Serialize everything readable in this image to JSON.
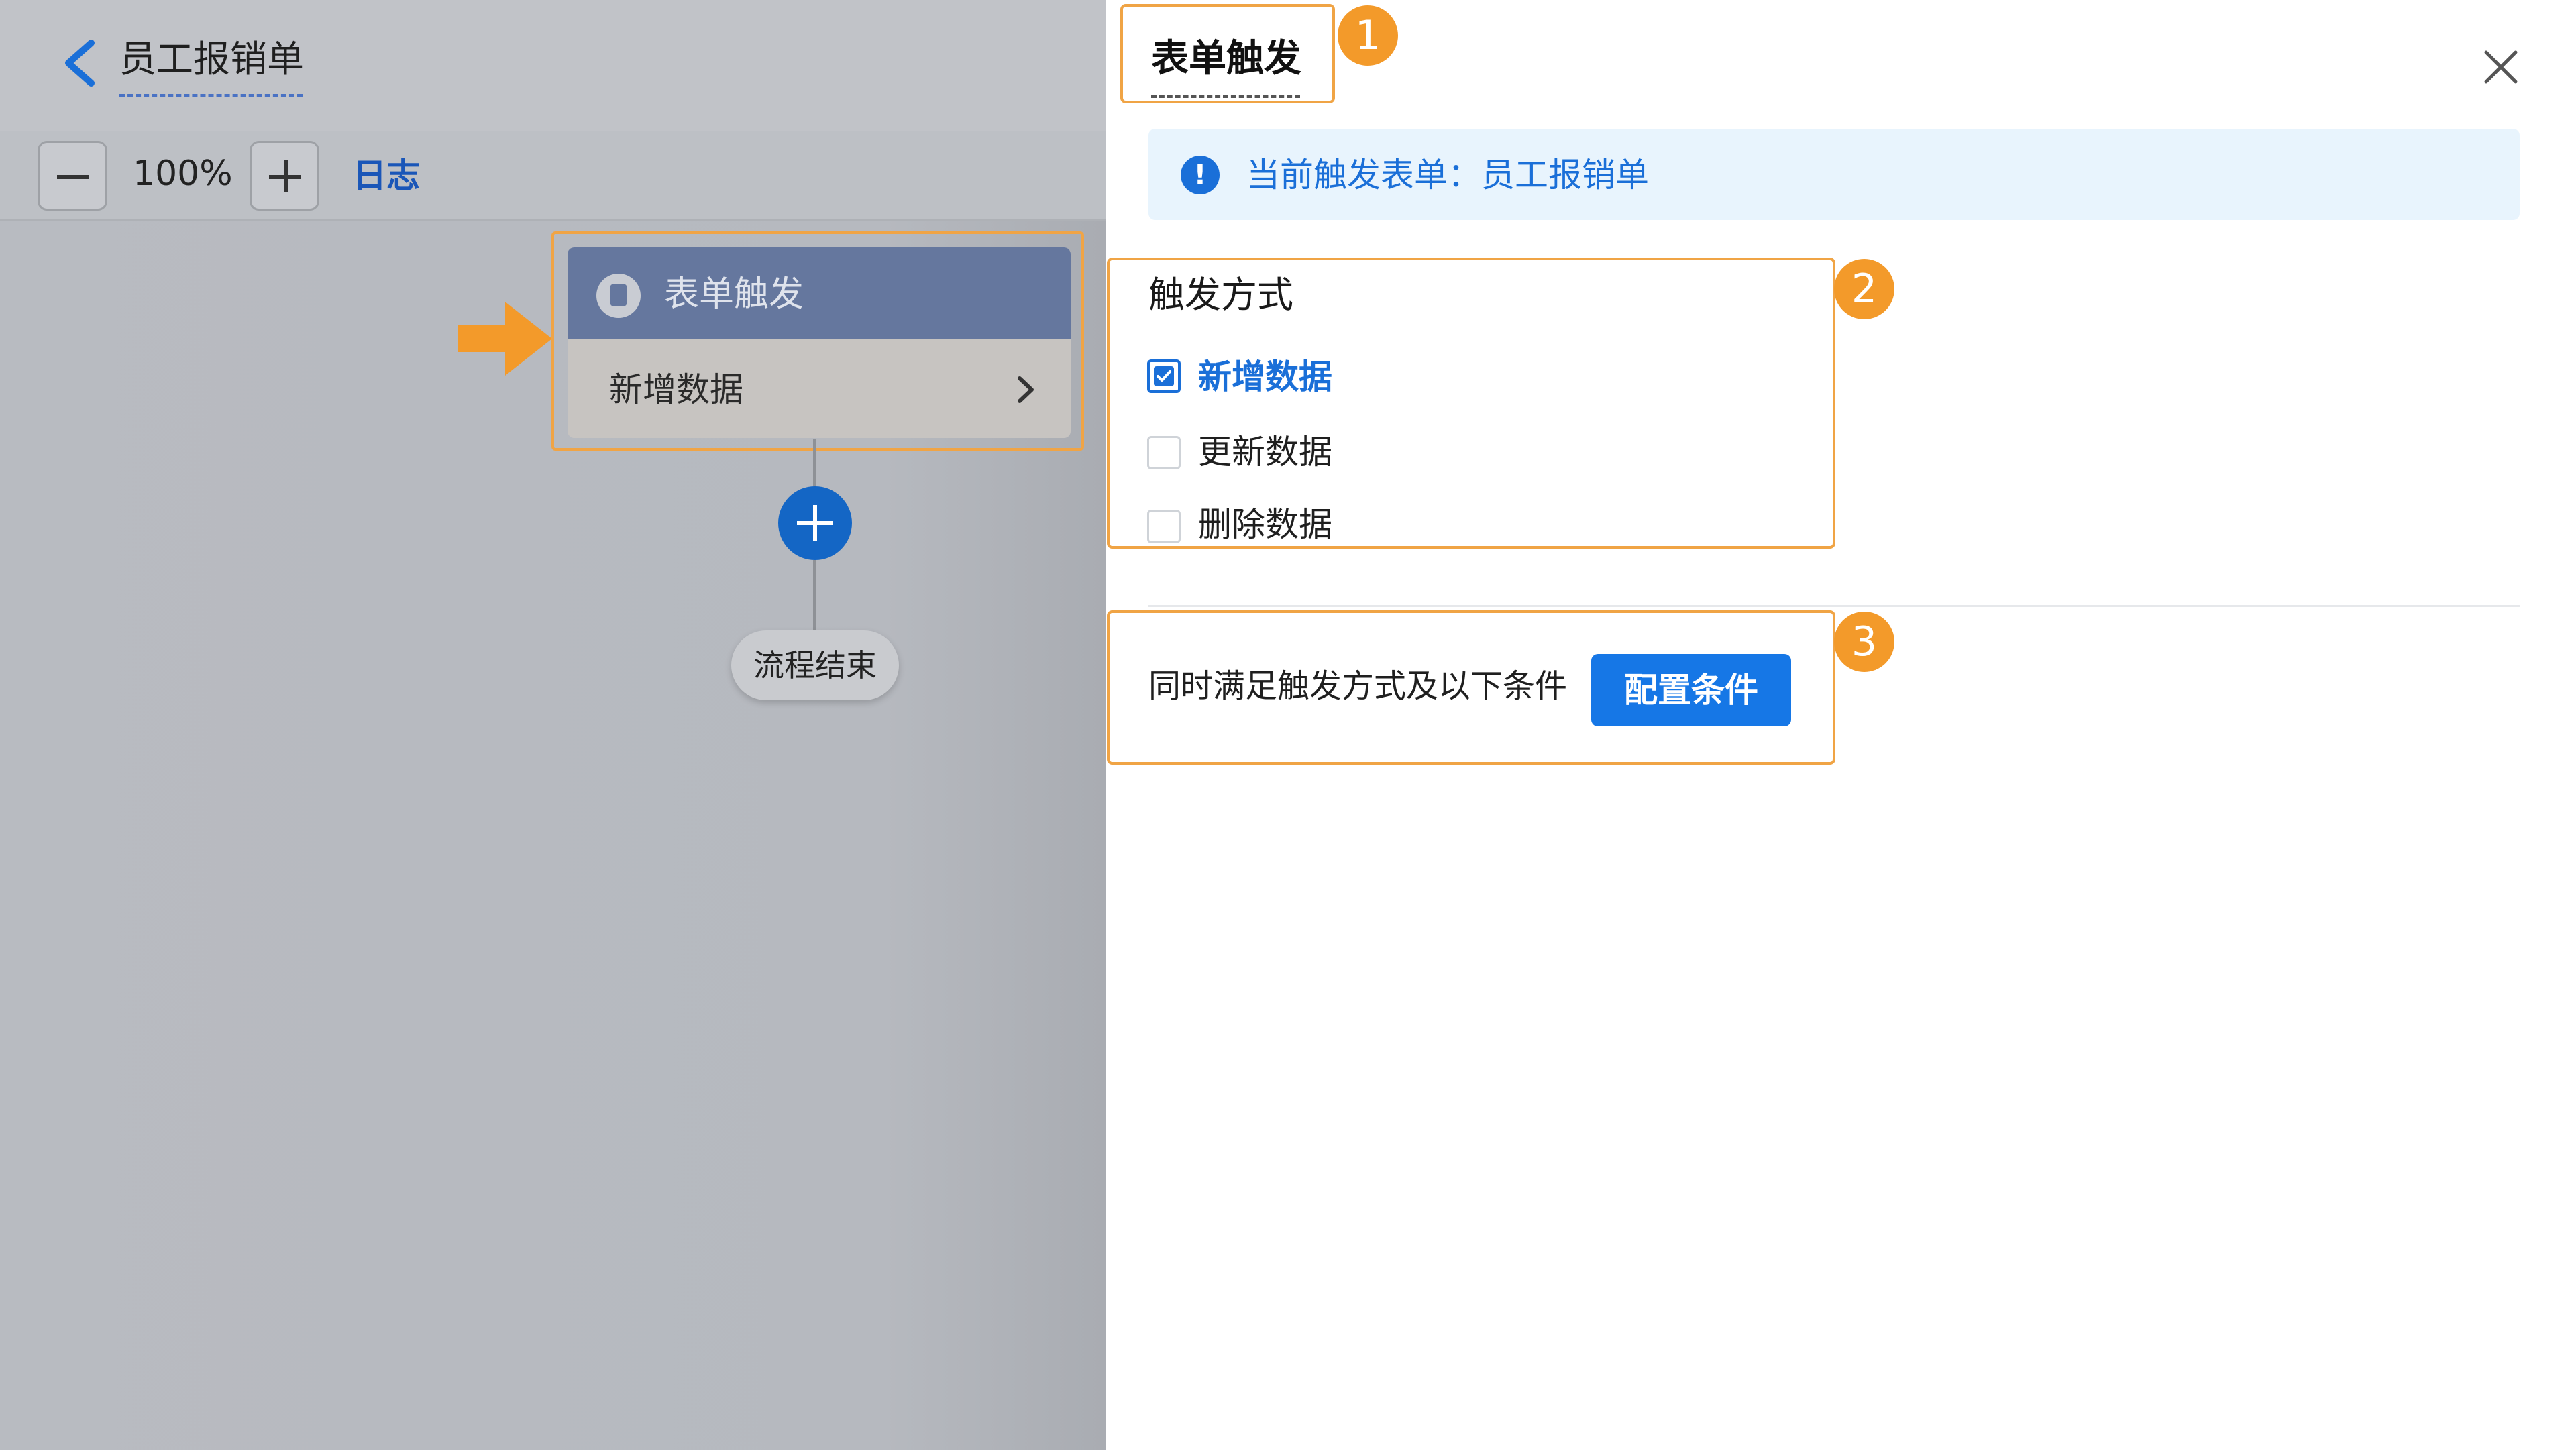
{
  "header": {
    "app_title": "员工报销单"
  },
  "toolbar": {
    "zoom_level": "100%",
    "log_label": "日志"
  },
  "flow": {
    "trigger_node": {
      "title": "表单触发",
      "subtitle": "新增数据"
    },
    "end_label": "流程结束"
  },
  "panel": {
    "title": "表单触发",
    "info_text": "当前触发表单：员工报销单",
    "trigger_section_label": "触发方式",
    "options": [
      {
        "label": "新增数据",
        "checked": true
      },
      {
        "label": "更新数据",
        "checked": false
      },
      {
        "label": "删除数据",
        "checked": false
      }
    ],
    "condition_text": "同时满足触发方式及以下条件",
    "config_button": "配置条件"
  },
  "annotations": {
    "badge_1": "1",
    "badge_2": "2",
    "badge_3": "3"
  },
  "colors": {
    "accent": "#1a6fd8",
    "callout": "#f0a445",
    "node_header": "#65779e"
  }
}
